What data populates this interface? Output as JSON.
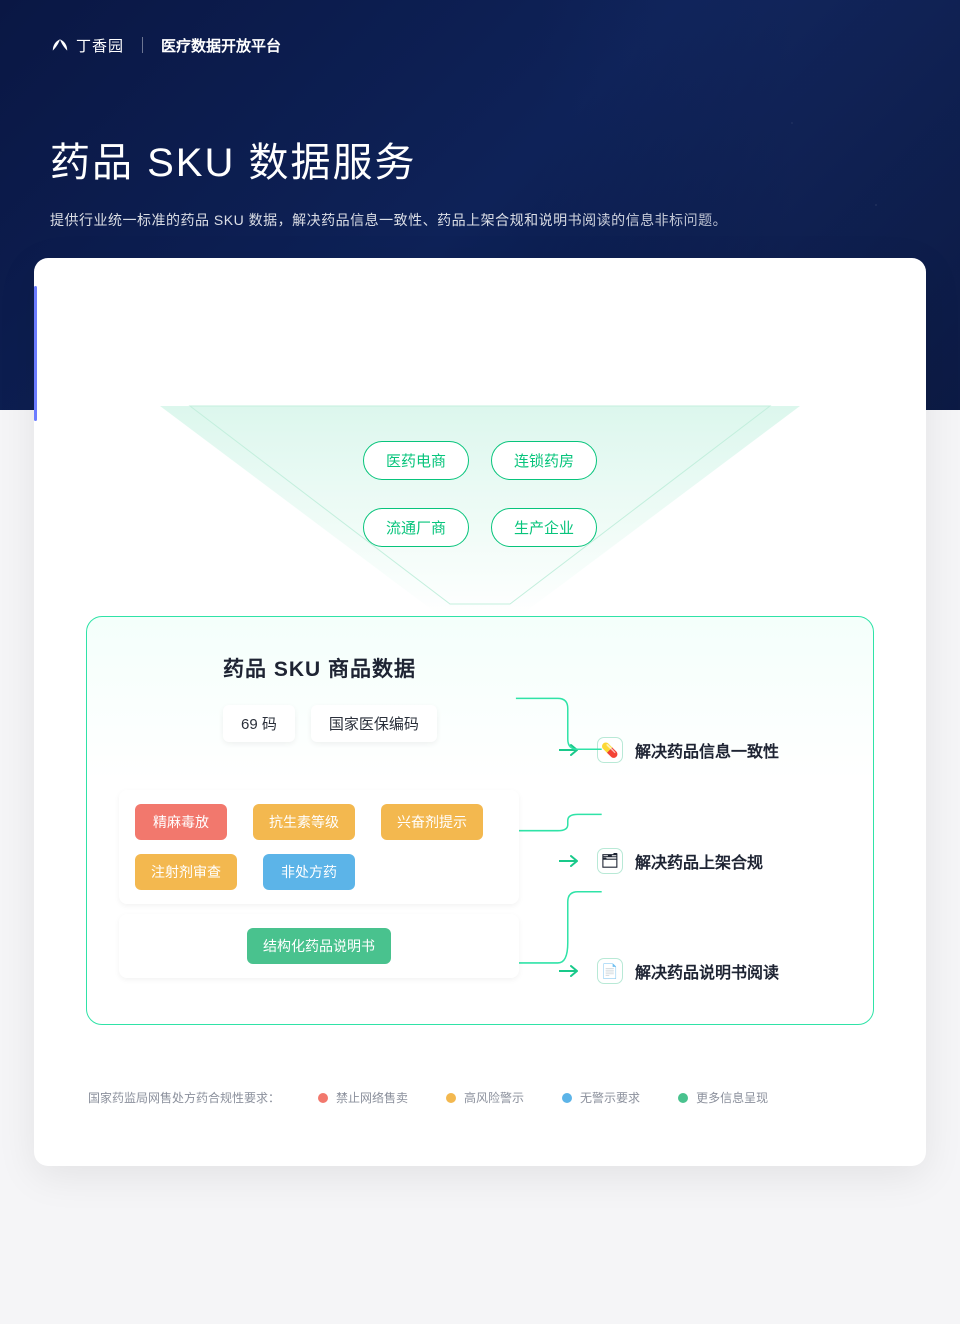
{
  "header": {
    "brand": "丁香园",
    "platform": "医疗数据开放平台"
  },
  "hero": {
    "title": "药品 SKU 数据服务",
    "subtitle": "提供行业统一标准的药品 SKU 数据，解决药品信息一致性、药品上架合规和说明书阅读的信息非标问题。"
  },
  "funnel": {
    "row1": [
      "医药电商",
      "连锁药房"
    ],
    "row2": [
      "流通厂商",
      "生产企业"
    ]
  },
  "mainbox": {
    "title": "药品 SKU 商品数据",
    "codes": [
      "69 码",
      "国家医保编码"
    ],
    "tag_rows": [
      [
        {
          "label": "精麻毒放",
          "color": "red"
        },
        {
          "label": "抗生素等级",
          "color": "orange"
        },
        {
          "label": "兴奋剂提示",
          "color": "orange"
        }
      ],
      [
        {
          "label": "注射剂审查",
          "color": "orange"
        },
        {
          "label": "非处方药",
          "color": "blue"
        }
      ]
    ],
    "instruction_tag": {
      "label": "结构化药品说明书",
      "color": "green"
    },
    "solutions": [
      {
        "icon": "💊",
        "text": "解决药品信息一致性"
      },
      {
        "icon": "🗂",
        "text": "解决药品上架合规"
      },
      {
        "icon": "📄",
        "text": "解决药品说明书阅读"
      }
    ]
  },
  "legend": {
    "lead": "国家药监局网售处方药合规性要求：",
    "items": [
      {
        "color": "red",
        "label": "禁止网络售卖"
      },
      {
        "color": "orange",
        "label": "高风险警示"
      },
      {
        "color": "blue",
        "label": "无警示要求"
      },
      {
        "color": "green",
        "label": "更多信息呈现"
      }
    ]
  }
}
